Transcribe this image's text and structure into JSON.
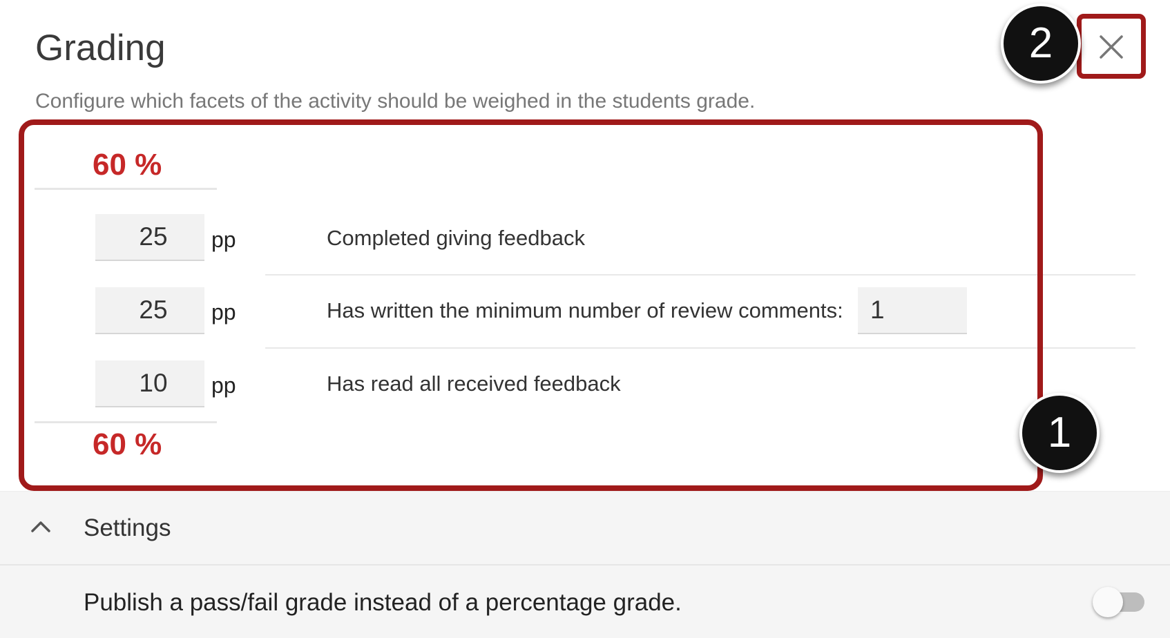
{
  "panel": {
    "title": "Grading",
    "subtitle": "Configure which facets of the activity should be weighed in the students grade."
  },
  "grading": {
    "total_top": "60 %",
    "total_bottom": "60 %",
    "unit": "pp",
    "criteria": [
      {
        "points": "25",
        "label": "Completed giving feedback"
      },
      {
        "points": "25",
        "label": "Has written the minimum number of review comments:",
        "min_count": "1"
      },
      {
        "points": "10",
        "label": "Has read all received feedback"
      }
    ]
  },
  "callouts": {
    "one": "1",
    "two": "2"
  },
  "settings": {
    "section_label": "Settings",
    "publish_label": "Publish a pass/fail grade instead of a percentage grade.",
    "publish_toggle_on": false
  },
  "colors": {
    "highlight": "#a01a1a",
    "total": "#c62828",
    "callout": "#111111"
  },
  "icons": {
    "close": "close-icon",
    "settings_toggle": "chevron-up-icon"
  }
}
